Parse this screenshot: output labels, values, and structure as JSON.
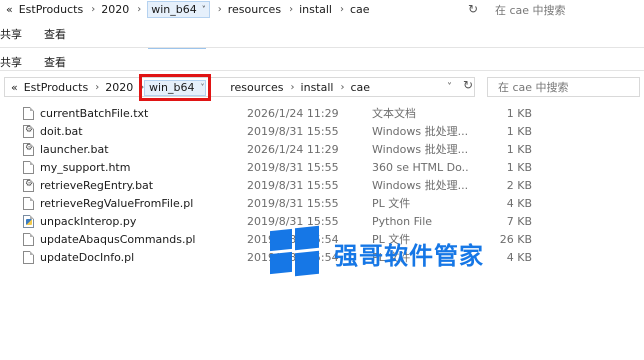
{
  "ghost": {
    "nav_back": "«",
    "path": [
      "EstProducts",
      "2020",
      "win_b64",
      "resources",
      "install",
      "cae"
    ],
    "current_segment": "win_b64",
    "search_placeholder": "在 cae 中搜索",
    "row1": [
      "共享",
      "查看"
    ],
    "row2": [
      "共享",
      "查看"
    ]
  },
  "address_bar": {
    "nav_back": "«",
    "path": [
      "EstProducts",
      "2020",
      "win_b64",
      "resources",
      "install",
      "cae"
    ],
    "current_segment": "win_b64",
    "search_placeholder": "在 cae 中搜索"
  },
  "files": [
    {
      "name": "currentBatchFile.txt",
      "date": "2026/1/24 11:29",
      "type": "文本文档",
      "size": "1 KB",
      "icon": "text-file-icon"
    },
    {
      "name": "doit.bat",
      "date": "2019/8/31 15:55",
      "type": "Windows 批处理...",
      "size": "1 KB",
      "icon": "batch-file-icon"
    },
    {
      "name": "launcher.bat",
      "date": "2026/1/24 11:29",
      "type": "Windows 批处理...",
      "size": "1 KB",
      "icon": "batch-file-icon"
    },
    {
      "name": "my_support.htm",
      "date": "2019/8/31 15:55",
      "type": "360 se HTML Do...",
      "size": "1 KB",
      "icon": "html-file-icon"
    },
    {
      "name": "retrieveRegEntry.bat",
      "date": "2019/8/31 15:55",
      "type": "Windows 批处理...",
      "size": "2 KB",
      "icon": "batch-file-icon"
    },
    {
      "name": "retrieveRegValueFromFile.pl",
      "date": "2019/8/31 15:55",
      "type": "PL 文件",
      "size": "4 KB",
      "icon": "pl-file-icon"
    },
    {
      "name": "unpackInterop.py",
      "date": "2019/8/31 15:55",
      "type": "Python File",
      "size": "7 KB",
      "icon": "python-file-icon"
    },
    {
      "name": "updateAbaqusCommands.pl",
      "date": "2019/8/31 15:54",
      "type": "PL 文件",
      "size": "26 KB",
      "icon": "pl-file-icon"
    },
    {
      "name": "updateDocInfo.pl",
      "date": "2019/8/31 15:54",
      "type": "PL 文件",
      "size": "4 KB",
      "icon": "pl-file-icon"
    }
  ],
  "watermark": {
    "text": "强哥软件管家"
  },
  "colors": {
    "highlight_border": "#e01414",
    "selected_segment_bg": "#e6f0fb",
    "watermark_blue": "#1677e6"
  }
}
